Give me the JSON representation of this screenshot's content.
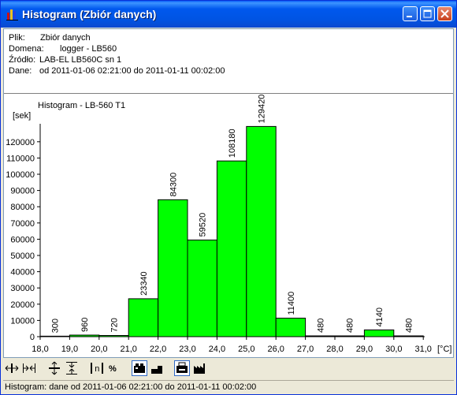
{
  "window": {
    "title": "Histogram (Zbiór danych)"
  },
  "info": {
    "plik_label": "Plik:",
    "plik_value": "Zbiór danych",
    "domena_label": "Domena:",
    "domena_value": "logger - LB560",
    "zrodlo_label": "Źródło:",
    "zrodlo_value": "LAB-EL LB560C sn 1",
    "dane_label": "Dane:",
    "dane_value": "od 2011-01-06 02:21:00 do 2011-01-11 00:02:00"
  },
  "chart_data": {
    "type": "bar",
    "title": "Histogram - LB-560 T1",
    "ylabel": "[sek]",
    "xlabel": "[°C]",
    "bin_edges": [
      18.0,
      19.0,
      20.0,
      21.0,
      22.0,
      23.0,
      24.0,
      25.0,
      26.0,
      27.0,
      28.0,
      29.0,
      30.0,
      31.0
    ],
    "x_tick_labels": [
      "18,0",
      "19,0",
      "20,0",
      "21,0",
      "22,0",
      "23,0",
      "24,0",
      "25,0",
      "26,0",
      "27,0",
      "28,0",
      "29,0",
      "30,0",
      "31,0"
    ],
    "values": [
      300,
      960,
      720,
      23340,
      84300,
      59520,
      108180,
      129420,
      11400,
      480,
      480,
      4140,
      480
    ],
    "value_labels": [
      "300",
      "960",
      "720",
      "23340",
      "84300",
      "59520",
      "108180",
      "129420",
      "11400",
      "480",
      "480",
      "4140",
      "480"
    ],
    "y_ticks": [
      0,
      10000,
      20000,
      30000,
      40000,
      50000,
      60000,
      70000,
      80000,
      90000,
      100000,
      110000,
      120000
    ],
    "ylim": [
      0,
      130000
    ],
    "xlim": [
      18.0,
      31.0
    ],
    "bar_color": "#00ff00",
    "grid": false,
    "legend": "none"
  },
  "toolbar": {
    "tools": [
      {
        "name": "zoom-x-in-icon",
        "pressed": false
      },
      {
        "name": "zoom-x-out-icon",
        "pressed": false
      },
      {
        "name": "zoom-y-in-icon",
        "pressed": false
      },
      {
        "name": "zoom-y-out-icon",
        "pressed": false
      },
      {
        "name": "count-mode-icon",
        "pressed": false,
        "text": "n"
      },
      {
        "name": "percent-mode-icon",
        "pressed": false,
        "text": "%"
      },
      {
        "name": "legend-toggle-icon",
        "pressed": true
      },
      {
        "name": "bar-style-icon",
        "pressed": false
      },
      {
        "name": "print-icon",
        "pressed": true
      },
      {
        "name": "factory-icon",
        "pressed": false
      }
    ]
  },
  "status": {
    "text": "Histogram: dane od 2011-01-06 02:21:00 do 2011-01-11 00:02:00"
  }
}
